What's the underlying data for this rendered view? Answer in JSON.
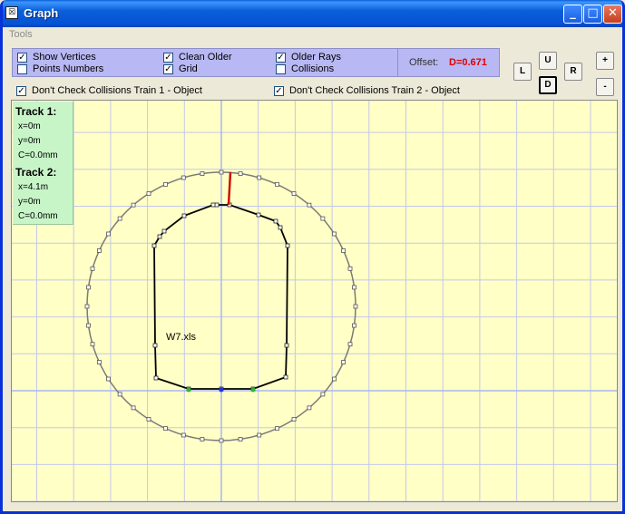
{
  "window": {
    "title": "Graph",
    "app_icon": "graph-app-icon",
    "minimize_icon": "_",
    "maximize_icon": "□",
    "close_icon": "✕"
  },
  "menu": {
    "items": [
      {
        "label": "Tools"
      }
    ]
  },
  "options": {
    "show_vertices": {
      "label": "Show Vertices",
      "checked": true
    },
    "points_numbers": {
      "label": "Points Numbers",
      "checked": false
    },
    "clean_older": {
      "label": "Clean Older",
      "checked": true
    },
    "grid": {
      "label": "Grid",
      "checked": true
    },
    "older_rays": {
      "label": "Older Rays",
      "checked": true
    },
    "collisions": {
      "label": "Collisions",
      "checked": false
    },
    "dont_check_1": {
      "label": "Don't Check Collisions Train 1 - Object",
      "checked": true
    },
    "dont_check_2": {
      "label": "Don't Check Collisions Train 2 - Object",
      "checked": true
    }
  },
  "offset": {
    "label": "Offset:",
    "value": "D=0.671"
  },
  "nav": {
    "up": "U",
    "left": "L",
    "down": "D",
    "right": "R",
    "down_pressed": true
  },
  "zoom": {
    "in": "+",
    "out": "-"
  },
  "tracks": [
    {
      "title": "Track 1:",
      "x": "x=0m",
      "y": "y=0m",
      "c": "C=0.0mm"
    },
    {
      "title": "Track 2:",
      "x": "x=4.1m",
      "y": "y=0m",
      "c": "C=0.0mm"
    }
  ],
  "canvas": {
    "profile_label": "W7.xls",
    "colors": {
      "background": "#ffffc6",
      "grid": "#c4c8ea",
      "axis": "#a9b5f2",
      "circle": "#7a7a7a",
      "profile": "#000000",
      "ray": "#cc1100",
      "green_point": "#2db52d",
      "blue_point": "#2233dd"
    }
  }
}
